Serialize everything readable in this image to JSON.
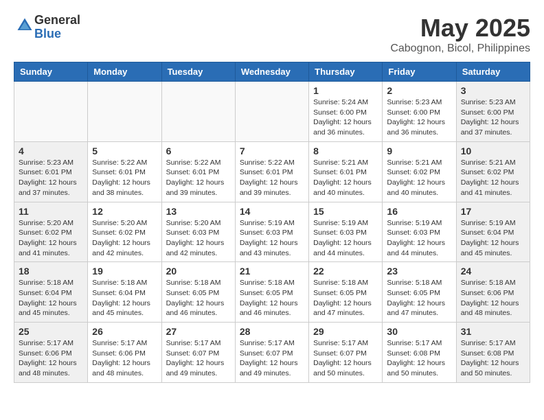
{
  "header": {
    "logo_general": "General",
    "logo_blue": "Blue",
    "month_title": "May 2025",
    "location": "Cabognon, Bicol, Philippines"
  },
  "days_of_week": [
    "Sunday",
    "Monday",
    "Tuesday",
    "Wednesday",
    "Thursday",
    "Friday",
    "Saturday"
  ],
  "weeks": [
    [
      {
        "day": "",
        "info": ""
      },
      {
        "day": "",
        "info": ""
      },
      {
        "day": "",
        "info": ""
      },
      {
        "day": "",
        "info": ""
      },
      {
        "day": "1",
        "info": "Sunrise: 5:24 AM\nSunset: 6:00 PM\nDaylight: 12 hours\nand 36 minutes."
      },
      {
        "day": "2",
        "info": "Sunrise: 5:23 AM\nSunset: 6:00 PM\nDaylight: 12 hours\nand 36 minutes."
      },
      {
        "day": "3",
        "info": "Sunrise: 5:23 AM\nSunset: 6:00 PM\nDaylight: 12 hours\nand 37 minutes."
      }
    ],
    [
      {
        "day": "4",
        "info": "Sunrise: 5:23 AM\nSunset: 6:01 PM\nDaylight: 12 hours\nand 37 minutes."
      },
      {
        "day": "5",
        "info": "Sunrise: 5:22 AM\nSunset: 6:01 PM\nDaylight: 12 hours\nand 38 minutes."
      },
      {
        "day": "6",
        "info": "Sunrise: 5:22 AM\nSunset: 6:01 PM\nDaylight: 12 hours\nand 39 minutes."
      },
      {
        "day": "7",
        "info": "Sunrise: 5:22 AM\nSunset: 6:01 PM\nDaylight: 12 hours\nand 39 minutes."
      },
      {
        "day": "8",
        "info": "Sunrise: 5:21 AM\nSunset: 6:01 PM\nDaylight: 12 hours\nand 40 minutes."
      },
      {
        "day": "9",
        "info": "Sunrise: 5:21 AM\nSunset: 6:02 PM\nDaylight: 12 hours\nand 40 minutes."
      },
      {
        "day": "10",
        "info": "Sunrise: 5:21 AM\nSunset: 6:02 PM\nDaylight: 12 hours\nand 41 minutes."
      }
    ],
    [
      {
        "day": "11",
        "info": "Sunrise: 5:20 AM\nSunset: 6:02 PM\nDaylight: 12 hours\nand 41 minutes."
      },
      {
        "day": "12",
        "info": "Sunrise: 5:20 AM\nSunset: 6:02 PM\nDaylight: 12 hours\nand 42 minutes."
      },
      {
        "day": "13",
        "info": "Sunrise: 5:20 AM\nSunset: 6:03 PM\nDaylight: 12 hours\nand 42 minutes."
      },
      {
        "day": "14",
        "info": "Sunrise: 5:19 AM\nSunset: 6:03 PM\nDaylight: 12 hours\nand 43 minutes."
      },
      {
        "day": "15",
        "info": "Sunrise: 5:19 AM\nSunset: 6:03 PM\nDaylight: 12 hours\nand 44 minutes."
      },
      {
        "day": "16",
        "info": "Sunrise: 5:19 AM\nSunset: 6:03 PM\nDaylight: 12 hours\nand 44 minutes."
      },
      {
        "day": "17",
        "info": "Sunrise: 5:19 AM\nSunset: 6:04 PM\nDaylight: 12 hours\nand 45 minutes."
      }
    ],
    [
      {
        "day": "18",
        "info": "Sunrise: 5:18 AM\nSunset: 6:04 PM\nDaylight: 12 hours\nand 45 minutes."
      },
      {
        "day": "19",
        "info": "Sunrise: 5:18 AM\nSunset: 6:04 PM\nDaylight: 12 hours\nand 45 minutes."
      },
      {
        "day": "20",
        "info": "Sunrise: 5:18 AM\nSunset: 6:05 PM\nDaylight: 12 hours\nand 46 minutes."
      },
      {
        "day": "21",
        "info": "Sunrise: 5:18 AM\nSunset: 6:05 PM\nDaylight: 12 hours\nand 46 minutes."
      },
      {
        "day": "22",
        "info": "Sunrise: 5:18 AM\nSunset: 6:05 PM\nDaylight: 12 hours\nand 47 minutes."
      },
      {
        "day": "23",
        "info": "Sunrise: 5:18 AM\nSunset: 6:05 PM\nDaylight: 12 hours\nand 47 minutes."
      },
      {
        "day": "24",
        "info": "Sunrise: 5:18 AM\nSunset: 6:06 PM\nDaylight: 12 hours\nand 48 minutes."
      }
    ],
    [
      {
        "day": "25",
        "info": "Sunrise: 5:17 AM\nSunset: 6:06 PM\nDaylight: 12 hours\nand 48 minutes."
      },
      {
        "day": "26",
        "info": "Sunrise: 5:17 AM\nSunset: 6:06 PM\nDaylight: 12 hours\nand 48 minutes."
      },
      {
        "day": "27",
        "info": "Sunrise: 5:17 AM\nSunset: 6:07 PM\nDaylight: 12 hours\nand 49 minutes."
      },
      {
        "day": "28",
        "info": "Sunrise: 5:17 AM\nSunset: 6:07 PM\nDaylight: 12 hours\nand 49 minutes."
      },
      {
        "day": "29",
        "info": "Sunrise: 5:17 AM\nSunset: 6:07 PM\nDaylight: 12 hours\nand 50 minutes."
      },
      {
        "day": "30",
        "info": "Sunrise: 5:17 AM\nSunset: 6:08 PM\nDaylight: 12 hours\nand 50 minutes."
      },
      {
        "day": "31",
        "info": "Sunrise: 5:17 AM\nSunset: 6:08 PM\nDaylight: 12 hours\nand 50 minutes."
      }
    ]
  ]
}
